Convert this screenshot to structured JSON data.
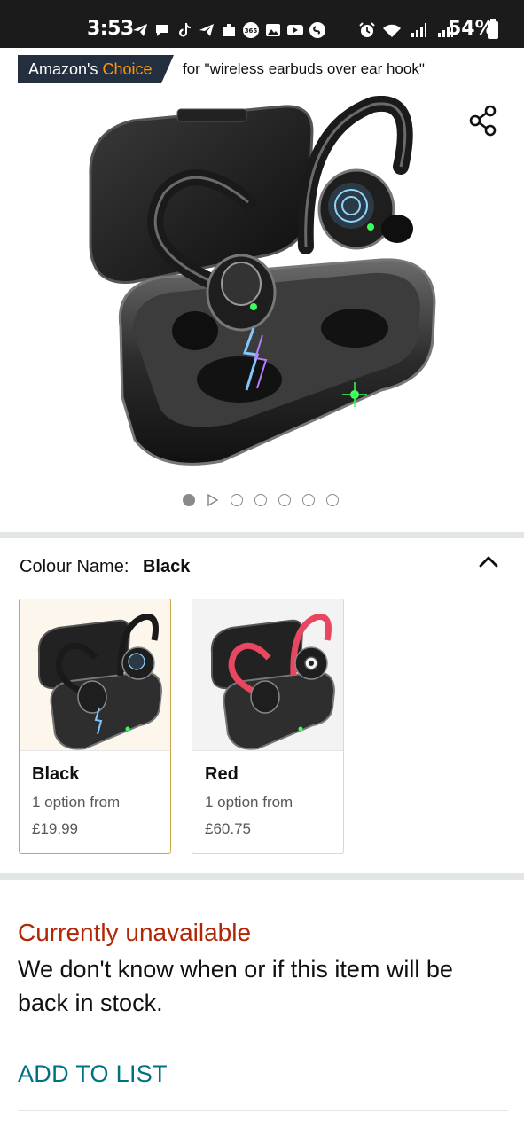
{
  "status_bar": {
    "time": "3:53",
    "battery": "54%",
    "left_icons": [
      "telegram-icon",
      "chat-icon",
      "tiktok-icon",
      "telegram-icon",
      "puzzle-icon",
      "app-365-icon",
      "gallery-icon",
      "youtube-icon",
      "shazam-icon"
    ],
    "right_icons": [
      "alarm-icon",
      "wifi-icon",
      "signal-icon",
      "signal-icon",
      "battery-icon"
    ]
  },
  "badge": {
    "prefix": "Amazon's",
    "choice": "Choice",
    "for_text": "for \"wireless earbuds over ear hook\""
  },
  "gallery": {
    "dots": [
      "image",
      "video",
      "image",
      "image",
      "image",
      "image",
      "image"
    ],
    "active_index": 0
  },
  "colour": {
    "label": "Colour Name:",
    "selected": "Black",
    "options": [
      {
        "name": "Black",
        "sub": "1 option from",
        "price": "£19.99"
      },
      {
        "name": "Red",
        "sub": "1 option from",
        "price": "£60.75"
      }
    ]
  },
  "availability": {
    "status": "Currently unavailable",
    "description": "We don't know when or if this item will be back in stock."
  },
  "actions": {
    "add_to_list": "ADD TO LIST"
  },
  "colors": {
    "badge_bg": "#232f3e",
    "choice_orange": "#ff9900",
    "unavailable_red": "#b12704",
    "link_teal": "#007185",
    "selected_border": "#c8a94a"
  }
}
